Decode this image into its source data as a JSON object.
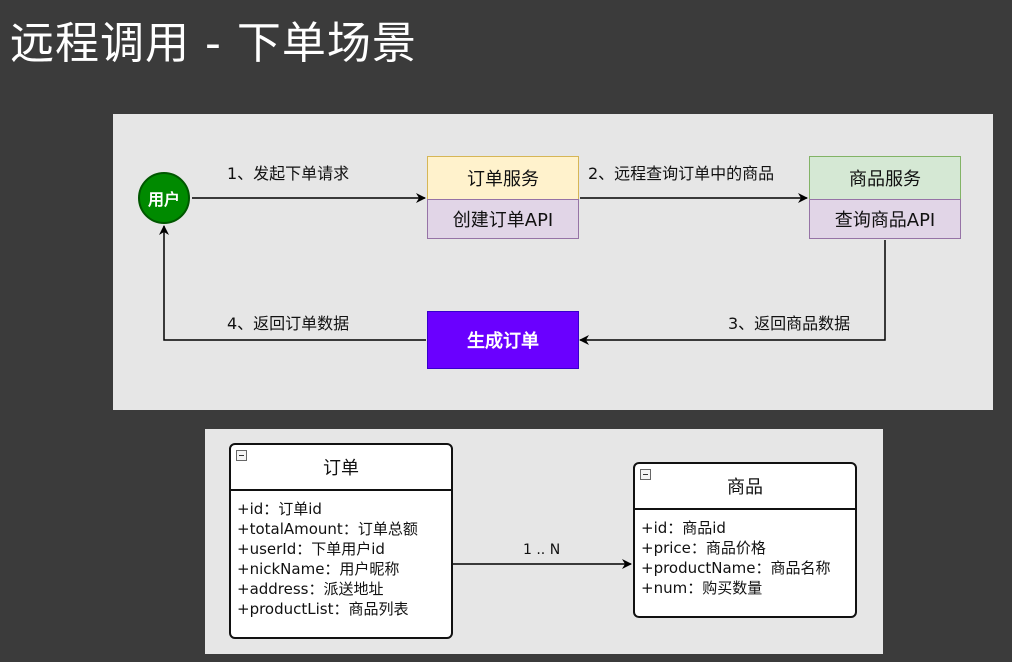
{
  "title": "远程调用 - 下单场景",
  "flow": {
    "user": "用户",
    "order_service": "订单服务",
    "create_order_api": "创建订单API",
    "product_service": "商品服务",
    "query_product_api": "查询商品API",
    "generate_order": "生成订单",
    "step1": "1、发起下单请求",
    "step2": "2、远程查询订单中的商品",
    "step3": "3、返回商品数据",
    "step4": "4、返回订单数据"
  },
  "uml": {
    "order": {
      "name": "订单",
      "attrs": [
        "+id：订单id",
        "+totalAmount：订单总额",
        "+userId：下单用户id",
        "+nickName：用户昵称",
        "+address：派送地址",
        "+productList：商品列表"
      ]
    },
    "product": {
      "name": "商品",
      "attrs": [
        "+id：商品id",
        "+price：商品价格",
        "+productName：商品名称",
        "+num：购买数量"
      ]
    },
    "multiplicity": "1 .. N"
  },
  "colors": {
    "user": "#008a00",
    "order_service": "#fff2cc",
    "api": "#e1d5e7",
    "product_service": "#d5e8d4",
    "generate_order": "#6a00ff"
  }
}
